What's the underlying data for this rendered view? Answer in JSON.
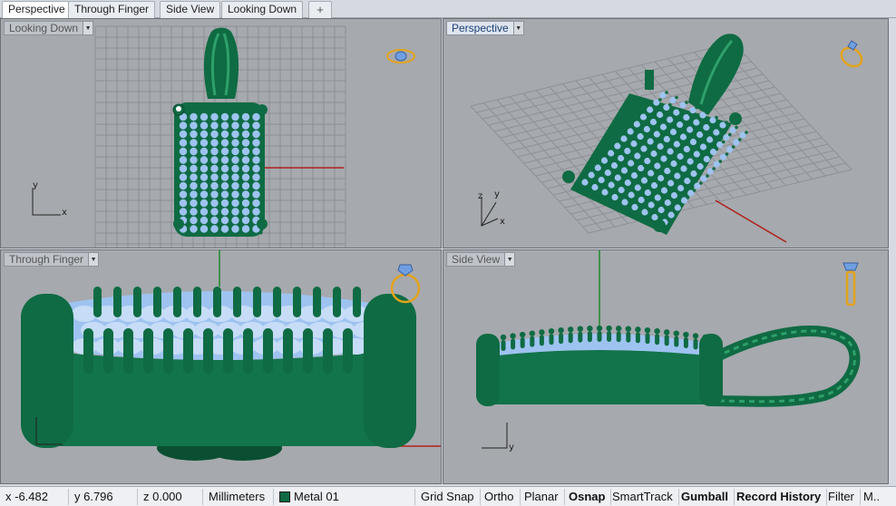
{
  "tabs": [
    {
      "label": "Perspective",
      "active": true
    },
    {
      "label": "Through Finger",
      "active": false
    },
    {
      "label": "Side View",
      "active": false
    },
    {
      "label": "Looking Down",
      "active": false
    }
  ],
  "viewports": {
    "top_left": {
      "label": "Looking Down",
      "active": false
    },
    "top_right": {
      "label": "Perspective",
      "active": true
    },
    "bottom_left": {
      "label": "Through Finger",
      "active": false
    },
    "bottom_right": {
      "label": "Side View",
      "active": false
    }
  },
  "axes": {
    "x": "x",
    "y": "y",
    "z": "z"
  },
  "status": {
    "x": "x -6.482",
    "y": "y 6.796",
    "z": "z 0.000",
    "units": "Millimeters",
    "layer": "Metal 01",
    "layer_color": "#0f6b43",
    "toggles": [
      {
        "label": "Grid Snap",
        "on": false
      },
      {
        "label": "Ortho",
        "on": false
      },
      {
        "label": "Planar",
        "on": false
      },
      {
        "label": "Osnap",
        "on": true
      },
      {
        "label": "SmartTrack",
        "on": false
      },
      {
        "label": "Gumball",
        "on": true
      },
      {
        "label": "Record History",
        "on": true
      },
      {
        "label": "Filter",
        "on": false
      },
      {
        "label": "M..",
        "on": false
      }
    ]
  },
  "icons": {
    "add_tab": "plus-icon",
    "nav_looking_down": "ring-top-icon",
    "nav_perspective": "ring-perspective-icon",
    "nav_through_finger": "ring-front-icon",
    "nav_side": "ring-side-icon"
  },
  "colors": {
    "metal": "#0f6b43",
    "stone": "#9ec3f0",
    "viewport_bg": "#a6a9ae",
    "grid": "#8c8f94",
    "x_axis": "#b0201a",
    "y_axis": "#1f8a2a",
    "nav_icon": "#e2a31c"
  }
}
